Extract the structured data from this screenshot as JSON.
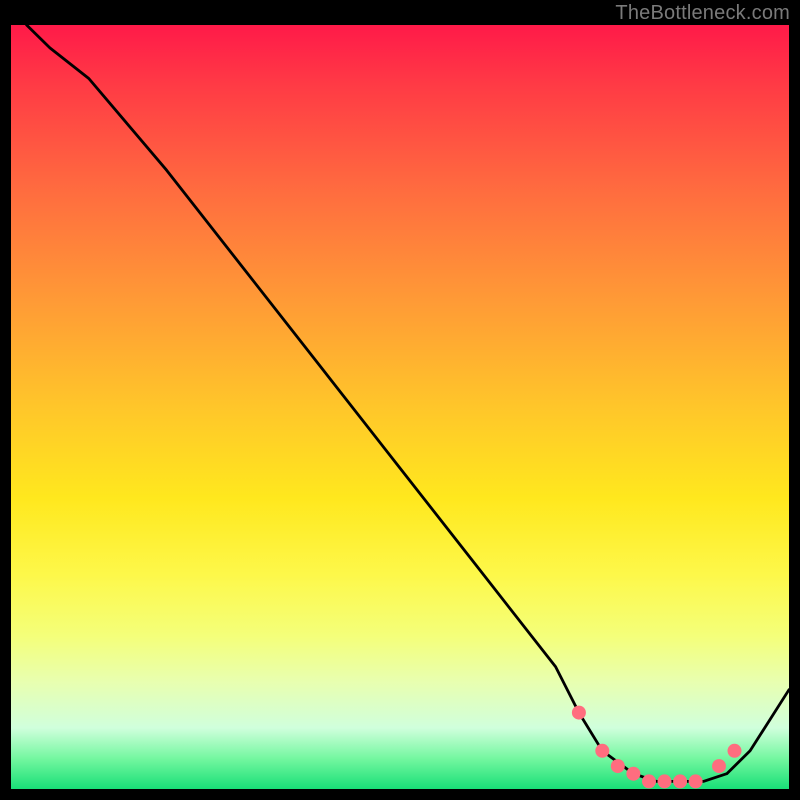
{
  "watermark": "TheBottleneck.com",
  "chart_data": {
    "type": "line",
    "title": "",
    "xlabel": "",
    "ylabel": "",
    "xlim": [
      0,
      100
    ],
    "ylim": [
      0,
      100
    ],
    "series": [
      {
        "name": "curve",
        "x": [
          2,
          5,
          10,
          20,
          30,
          40,
          50,
          60,
          70,
          73,
          76,
          80,
          83,
          86,
          89,
          92,
          95,
          100
        ],
        "values": [
          100,
          97,
          93,
          81,
          68,
          55,
          42,
          29,
          16,
          10,
          5,
          2,
          1,
          1,
          1,
          2,
          5,
          13
        ]
      }
    ],
    "markers": {
      "name": "highlighted-points",
      "color": "#ff6d7f",
      "x": [
        73,
        76,
        78,
        80,
        82,
        84,
        86,
        88,
        91,
        93
      ],
      "values": [
        10,
        5,
        3,
        2,
        1,
        1,
        1,
        1,
        3,
        5
      ]
    },
    "gradient_stops": [
      {
        "pos": 0.0,
        "color": "#ff1a49"
      },
      {
        "pos": 0.22,
        "color": "#ff6d3f"
      },
      {
        "pos": 0.5,
        "color": "#ffc62a"
      },
      {
        "pos": 0.72,
        "color": "#fdf84a"
      },
      {
        "pos": 0.92,
        "color": "#d0ffdc"
      },
      {
        "pos": 1.0,
        "color": "#18df77"
      }
    ]
  }
}
